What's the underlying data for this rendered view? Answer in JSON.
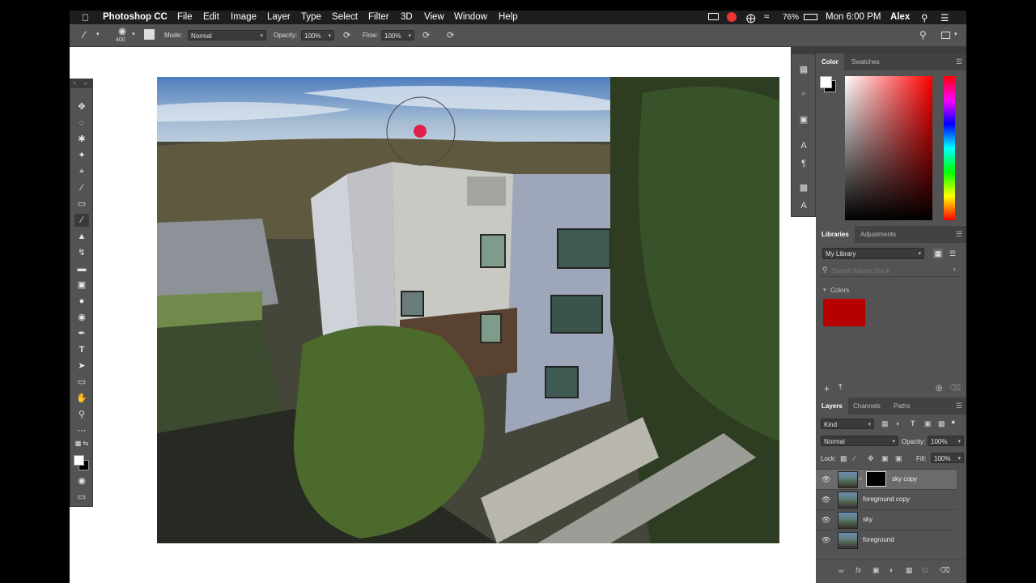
{
  "menubar": {
    "apple": "",
    "app_name": "Photoshop CC",
    "items": [
      "File",
      "Edit",
      "Image",
      "Layer",
      "Type",
      "Select",
      "Filter",
      "3D",
      "View",
      "Window",
      "Help"
    ],
    "battery": "76%",
    "clock": "Mon 6:00 PM",
    "user": "Alex"
  },
  "options": {
    "brush_size": "400",
    "mode_label": "Mode:",
    "mode_value": "Normal",
    "opacity_label": "Opacity:",
    "opacity_value": "100%",
    "flow_label": "Flow:",
    "flow_value": "100%"
  },
  "toolbar": {
    "tools": [
      "move",
      "marquee",
      "lasso",
      "magic-wand",
      "crop",
      "eyedropper",
      "healing",
      "brush",
      "clone-stamp",
      "history-brush",
      "eraser",
      "gradient",
      "blur",
      "dodge",
      "pen",
      "type",
      "path-select",
      "shape",
      "hand",
      "zoom",
      "more"
    ],
    "active": "brush"
  },
  "color_panel": {
    "tabs": [
      "Color",
      "Swatches"
    ],
    "active_tab": "Color",
    "hue_color": "#ff0000"
  },
  "libraries_panel": {
    "tabs": [
      "Libraries",
      "Adjustments"
    ],
    "active_tab": "Libraries",
    "library_name": "My Library",
    "search_placeholder": "Search Adobe Stock",
    "colors_label": "Colors",
    "swatch_color": "#b70000"
  },
  "layers_panel": {
    "tabs": [
      "Layers",
      "Channels",
      "Paths"
    ],
    "active_tab": "Layers",
    "kind": "Kind",
    "blend_mode": "Normal",
    "opacity_label": "Opacity:",
    "opacity_value": "100%",
    "lock_label": "Lock:",
    "fill_label": "Fill:",
    "fill_value": "100%",
    "layers": [
      {
        "name": "sky copy",
        "selected": true,
        "has_mask": true
      },
      {
        "name": "foreground copy",
        "selected": false,
        "has_mask": false
      },
      {
        "name": "sky",
        "selected": false,
        "has_mask": false
      },
      {
        "name": "foreground",
        "selected": false,
        "has_mask": false
      }
    ]
  }
}
